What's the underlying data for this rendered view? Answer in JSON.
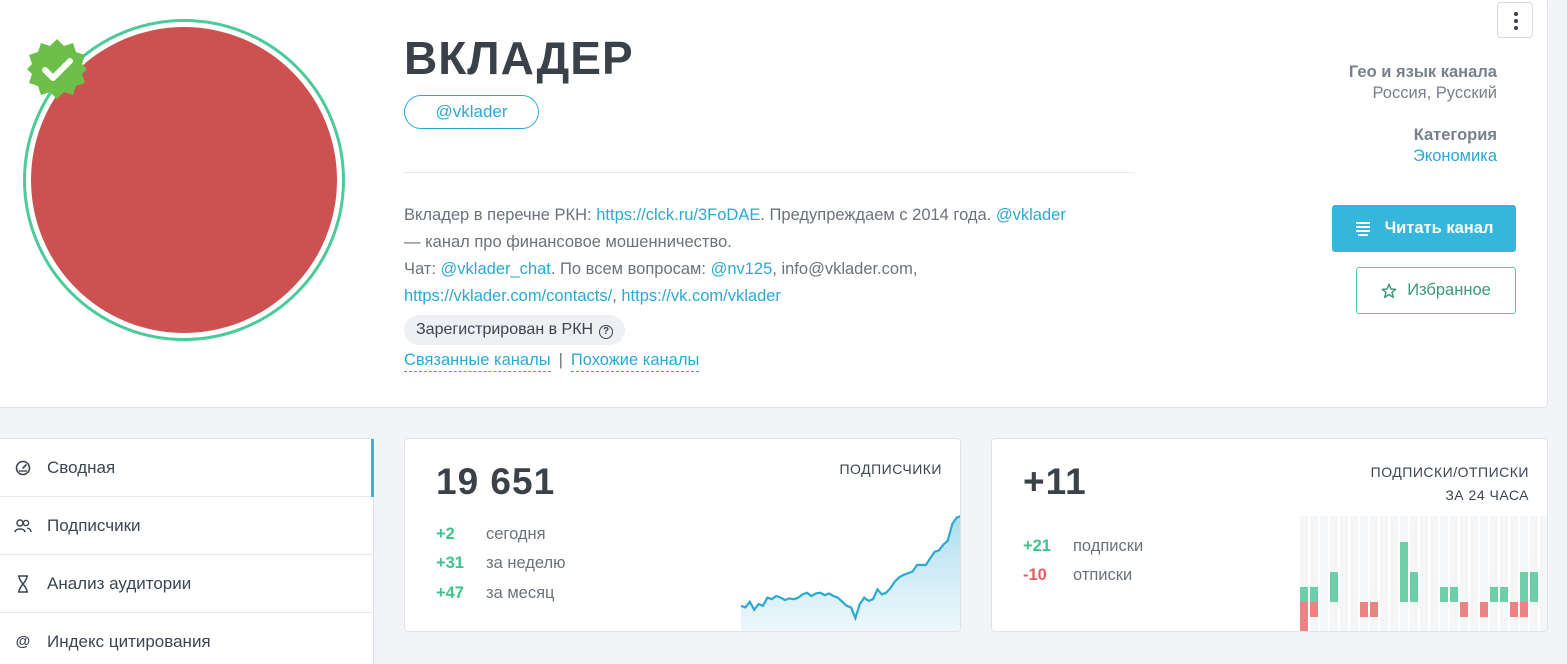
{
  "channel": {
    "title": "ВКЛАДЕР",
    "handle": "@vklader",
    "avatar_color": "#cd5150"
  },
  "description": {
    "line1_a": "Вкладер в перечне РКН: ",
    "line1_link1": "https://clck.ru/3FoDAE",
    "line1_b": ". Предупреждаем с 2014 года. ",
    "line1_link2": "@vklader",
    "line2": "— канал про финансовое мошенничество.",
    "line3_a": "Чат: ",
    "line3_link1": "@vklader_chat",
    "line3_b": ". По всем вопросам: ",
    "line3_link2": "@nv125",
    "line3_c": ", info@vklader.com,",
    "line4_link1": "https://vklader.com/contacts/",
    "line4_sep": ", ",
    "line4_link2": "https://vk.com/vklader"
  },
  "rkn_badge": "Зарегистрирован в РКН",
  "related": {
    "linked": "Связанные каналы",
    "separator": "|",
    "similar": "Похожие каналы"
  },
  "meta": {
    "geo_label": "Гео и язык канала",
    "geo_value": "Россия, Русский",
    "category_label": "Категория",
    "category_value": "Экономика"
  },
  "buttons": {
    "read": "Читать канал",
    "favorite": "Избранное"
  },
  "sidebar": {
    "items": [
      {
        "label": "Сводная",
        "icon": "dashboard-icon"
      },
      {
        "label": "Подписчики",
        "icon": "users-icon"
      },
      {
        "label": "Анализ аудитории",
        "icon": "dna-icon"
      },
      {
        "label": "Индекс цитирования",
        "icon": "at-icon"
      }
    ]
  },
  "subscribers_card": {
    "total": "19 651",
    "label": "ПОДПИСЧИКИ",
    "rows": [
      {
        "value": "+2",
        "label": "сегодня"
      },
      {
        "value": "+31",
        "label": "за неделю"
      },
      {
        "value": "+47",
        "label": "за месяц"
      }
    ],
    "sparkline": [
      50,
      48,
      55,
      45,
      52,
      50,
      60,
      58,
      62,
      60,
      57,
      59,
      58,
      60,
      64,
      66,
      62,
      65,
      66,
      63,
      65,
      62,
      60,
      55,
      50,
      48,
      35,
      52,
      60,
      56,
      58,
      70,
      64,
      66,
      72,
      80,
      85,
      88,
      90,
      92,
      100,
      100,
      100,
      108,
      116,
      118,
      125,
      130,
      150,
      158,
      160
    ]
  },
  "changes_card": {
    "total": "+11",
    "label_line1": "ПОДПИСКИ/ОТПИСКИ",
    "label_line2": "ЗА 24 ЧАСА",
    "rows": [
      {
        "value": "+21",
        "label": "подписки",
        "sign": "pos"
      },
      {
        "value": "-10",
        "label": "отписки",
        "sign": "neg"
      }
    ],
    "bars_up": [
      1,
      1,
      0,
      2,
      0,
      0,
      0,
      0,
      0,
      0,
      4,
      2,
      0,
      0,
      1,
      1,
      0,
      0,
      0,
      1,
      1,
      0,
      2,
      2,
      0
    ],
    "bars_down": [
      2,
      1,
      0,
      0,
      0,
      0,
      1,
      1,
      0,
      0,
      0,
      0,
      0,
      0,
      0,
      0,
      1,
      0,
      1,
      0,
      0,
      1,
      1,
      0,
      0
    ]
  },
  "colors": {
    "accent": "#2ba9d3",
    "positive": "#3fc28c",
    "negative": "#e85c5c",
    "verified": "#6cc04a"
  }
}
